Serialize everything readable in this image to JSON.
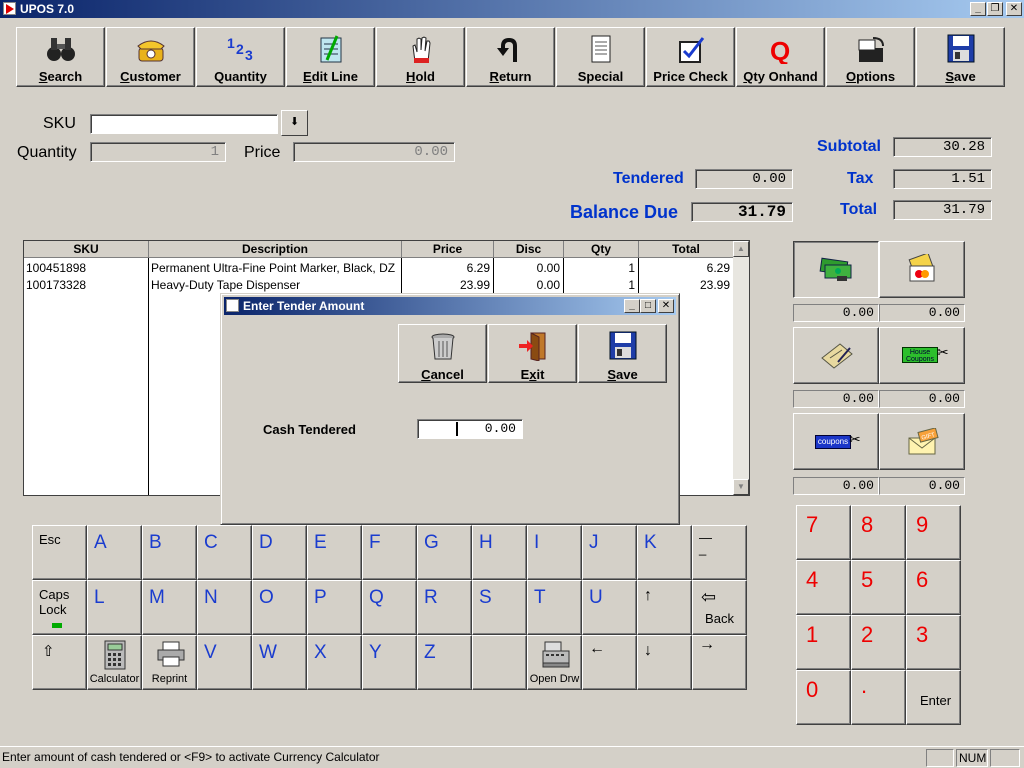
{
  "window": {
    "title": "UPOS 7.0",
    "btn_min": "_",
    "btn_restore": "❐",
    "btn_close": "✕"
  },
  "toolbar": [
    {
      "key": "search",
      "label_u": "S",
      "label_rest": "earch",
      "icon": "binoculars-icon"
    },
    {
      "key": "customer",
      "label_u": "C",
      "label_rest": "ustomer",
      "icon": "telephone-icon"
    },
    {
      "key": "quantity",
      "label_u": "",
      "label_rest": "Quantity",
      "icon": "numbers-123-icon"
    },
    {
      "key": "edit-line",
      "label_u": "E",
      "label_rest": "dit Line",
      "icon": "notepad-icon"
    },
    {
      "key": "hold",
      "label_u": "H",
      "label_rest": "old",
      "icon": "hand-stop-icon"
    },
    {
      "key": "return",
      "label_u": "R",
      "label_rest": "eturn",
      "icon": "return-arrow-icon"
    },
    {
      "key": "special",
      "label_u": "",
      "label_rest": "Special",
      "icon": "document-icon"
    },
    {
      "key": "price-check",
      "label_u": "",
      "label_rest": "Price Check",
      "icon": "checkbox-icon"
    },
    {
      "key": "qty-onhand",
      "label_u": "Q",
      "label_rest": "ty Onhand",
      "icon": "q-letter-icon"
    },
    {
      "key": "options",
      "label_u": "O",
      "label_rest": "ptions",
      "icon": "options-icon"
    },
    {
      "key": "save",
      "label_u": "S",
      "label_rest": "ave",
      "icon": "floppy-disk-icon"
    }
  ],
  "entry": {
    "sku_label": "SKU",
    "sku_value": "",
    "dropdown_glyph": "⬇",
    "quantity_label": "Quantity",
    "quantity_value": "1",
    "price_label": "Price",
    "price_value": "0.00"
  },
  "totals": {
    "tendered_label": "Tendered",
    "tendered_value": "0.00",
    "balance_label": "Balance Due",
    "balance_value": "31.79",
    "subtotal_label": "Subtotal",
    "subtotal_value": "30.28",
    "tax_label": "Tax",
    "tax_value": "1.51",
    "total_label": "Total",
    "total_value": "31.79"
  },
  "grid": {
    "headers": [
      "SKU",
      "Description",
      "Price",
      "Disc",
      "Qty",
      "Total"
    ],
    "rows": [
      [
        "100451898",
        "Permanent Ultra-Fine Point Marker, Black, DZ",
        "6.29",
        "0.00",
        "1",
        "6.29"
      ],
      [
        "100173328",
        "Heavy-Duty Tape Dispenser",
        "23.99",
        "0.00",
        "1",
        "23.99"
      ]
    ]
  },
  "tender_amounts": [
    "0.00",
    "0.00",
    "0.00",
    "0.00",
    "0.00",
    "0.00"
  ],
  "tender_labels": {
    "house_coupons": "House Coupons",
    "coupons": "coupons",
    "gift": "GIFT"
  },
  "keyboard": {
    "esc": "Esc",
    "caps1": "Caps",
    "caps2": "Lock",
    "back": "Back",
    "calculator": "Calculator",
    "reprint": "Reprint",
    "open_drawer": "Open Drw",
    "row1": [
      "A",
      "B",
      "C",
      "D",
      "E",
      "F",
      "G",
      "H",
      "I",
      "J",
      "K"
    ],
    "row2": [
      "L",
      "M",
      "N",
      "O",
      "P",
      "Q",
      "R",
      "S",
      "T",
      "U"
    ],
    "row3": [
      "V",
      "W",
      "X",
      "Y",
      "Z"
    ],
    "dash": "—\n_",
    "up": "↑",
    "down": "↓",
    "left": "←",
    "right": "→",
    "shift": "⇧",
    "back_arrow": "⇦"
  },
  "numpad": {
    "keys": [
      "7",
      "8",
      "9",
      "4",
      "5",
      "6",
      "1",
      "2",
      "3",
      "0",
      "."
    ],
    "enter": "Enter"
  },
  "dialog": {
    "title": "Enter Tender Amount",
    "cancel_u": "C",
    "cancel_rest": "ancel",
    "exit_pre": "E",
    "exit_u": "x",
    "exit_rest": "it",
    "save_u": "S",
    "save_rest": "ave",
    "cash_label": "Cash Tendered",
    "cash_value": "0.00"
  },
  "status": {
    "message": "Enter amount of cash tendered or <F9> to activate Currency Calculator",
    "num": "NUM"
  },
  "colors": {
    "accent_blue": "#0033cc",
    "numpad_red": "#ee0000",
    "key_blue": "#1a3ccf"
  }
}
